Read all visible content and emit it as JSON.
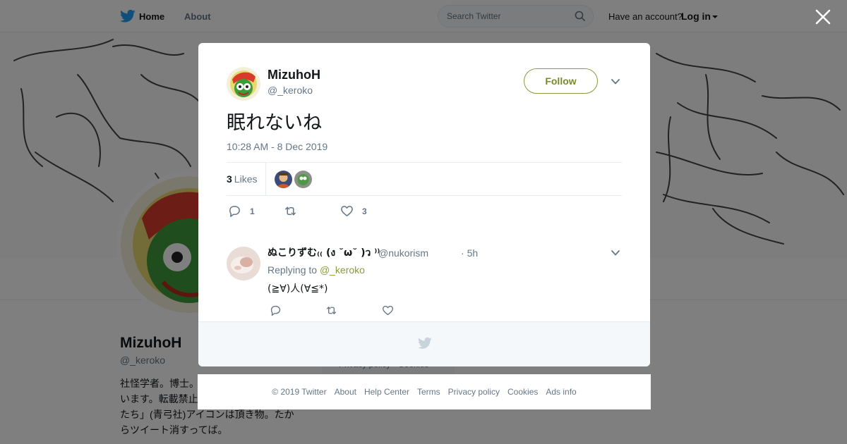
{
  "header": {
    "nav_home": "Home",
    "nav_about": "About",
    "search_placeholder": "Search Twitter",
    "have_account": "Have an account?",
    "login": "Log in"
  },
  "profile": {
    "name": "MizuhoH",
    "handle": "@_keroko",
    "bio_lines": [
      "社怪学者。博士。",
      "います。転載禁止",
      "たち」(青弓社)アイコンは頂き物。たか",
      "らツイート消すってば。"
    ],
    "footer_partial": "Privacy policy · Cookies"
  },
  "tweet": {
    "author_name": "MizuhoH",
    "author_handle": "@_keroko",
    "follow_label": "Follow",
    "text": "眠れないね",
    "timestamp": "10:28 AM - 8 Dec 2019",
    "likes_count": "3",
    "likes_label": "Likes",
    "reply_count": "1",
    "retweet_count": "",
    "like_count": "3"
  },
  "reply": {
    "name": "ぬこりずむ₍₍ (ง ˘ω˘ )ว ⁾⁾",
    "handle": "@nukorism",
    "separator": "·",
    "time": "5h",
    "replying_to_label": "Replying to",
    "replying_to_handle": "@_keroko",
    "text": "(≧∀)人(∀≦*)"
  },
  "site_footer": {
    "copyright": "© 2019 Twitter",
    "links": [
      "About",
      "Help Center",
      "Terms",
      "Privacy policy",
      "Cookies",
      "Ads info"
    ]
  },
  "colors": {
    "accent": "#8b9a3a",
    "text_secondary": "#657786",
    "twitter_blue": "#1da1f2"
  }
}
